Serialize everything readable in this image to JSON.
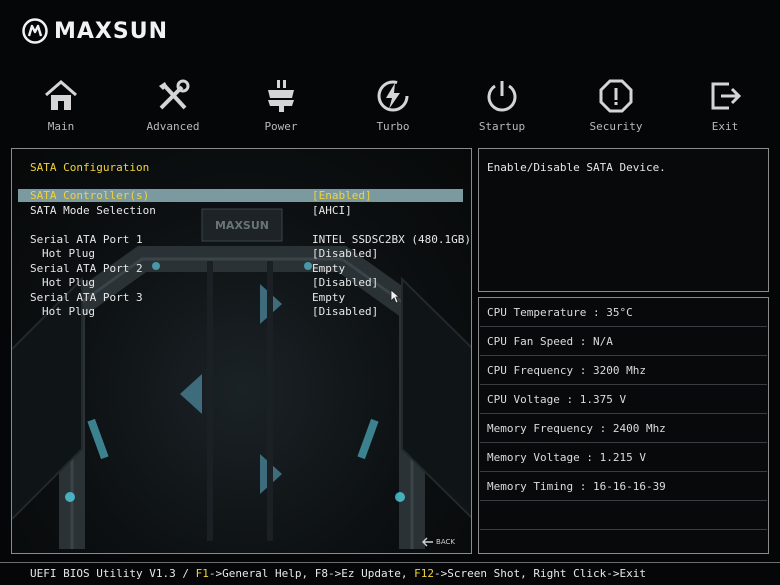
{
  "brand": {
    "name": "MAXSUN"
  },
  "tabs": [
    {
      "label": "Main",
      "icon": "home-icon"
    },
    {
      "label": "Advanced",
      "icon": "tools-icon"
    },
    {
      "label": "Power",
      "icon": "power-plug-icon"
    },
    {
      "label": "Turbo",
      "icon": "turbo-icon"
    },
    {
      "label": "Startup",
      "icon": "startup-icon"
    },
    {
      "label": "Security",
      "icon": "security-icon"
    },
    {
      "label": "Exit",
      "icon": "exit-icon"
    }
  ],
  "main": {
    "section_title": "SATA Configuration",
    "rows": [
      {
        "label": "SATA Controller(s)",
        "value": "[Enabled]",
        "selected": true
      },
      {
        "label": "SATA Mode Selection",
        "value": "[AHCI]"
      },
      {
        "label": "Serial ATA Port 1",
        "value": "INTEL SSDSC2BX (480.1GB)"
      },
      {
        "label": "Hot Plug",
        "value": "[Disabled]"
      },
      {
        "label": "Serial ATA Port 2",
        "value": "Empty"
      },
      {
        "label": "Hot Plug",
        "value": "[Disabled]"
      },
      {
        "label": "Serial ATA Port 3",
        "value": "Empty"
      },
      {
        "label": "Hot Plug",
        "value": "[Disabled]"
      }
    ],
    "back_label": "BACK"
  },
  "help": {
    "text": "Enable/Disable SATA Device."
  },
  "status": [
    "CPU Temperature : 35°C",
    "CPU Fan Speed : N/A",
    "CPU Frequency : 3200 Mhz",
    "CPU Voltage : 1.375 V",
    "Memory Frequency : 2400 Mhz",
    "Memory Voltage : 1.215 V",
    "Memory Timing : 16-16-16-39"
  ],
  "footer": {
    "prefix": "UEFI BIOS Utility V1.3 / ",
    "f1_key": "F1",
    "f1_text": "->General Help, F8->Ez Update, ",
    "f12_key": "F12",
    "f12_text": "->Screen Shot, Right Click->Exit"
  },
  "colors": {
    "accent": "#f2d23c",
    "selected_row": "#7b9aa0",
    "border": "#8a8a8a"
  }
}
